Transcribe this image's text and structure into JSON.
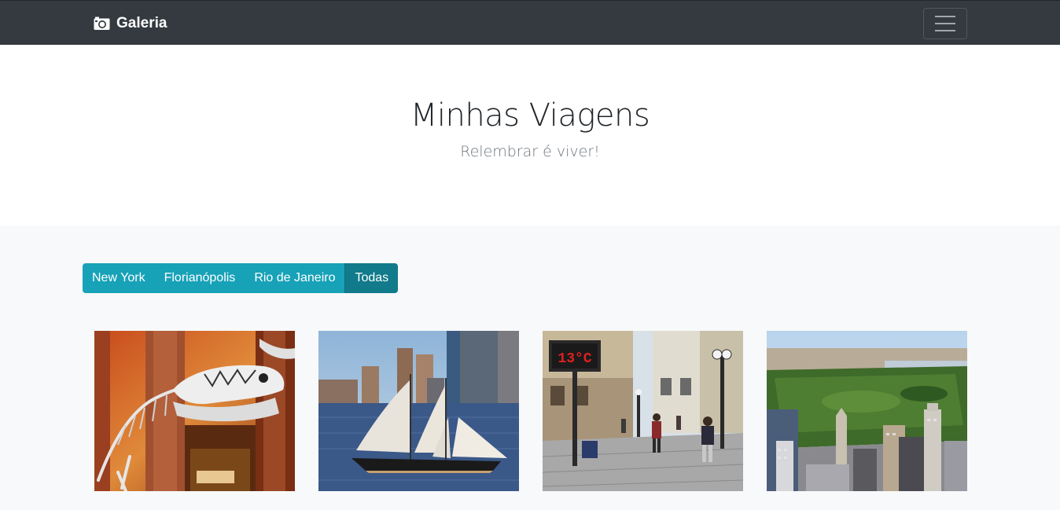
{
  "navbar": {
    "brand": "Galeria",
    "brand_icon": "camera-icon",
    "toggler_icon": "hamburger-menu-icon"
  },
  "hero": {
    "title": "Minhas Viagens",
    "subtitle": "Relembrar é viver!"
  },
  "filters": [
    {
      "label": "New York",
      "active": false
    },
    {
      "label": "Florianópolis",
      "active": false
    },
    {
      "label": "Rio de Janeiro",
      "active": false
    },
    {
      "label": "Todas",
      "active": true
    }
  ],
  "colors": {
    "navbar": "#343a40",
    "filter_button": "#17a2b8",
    "filter_button_active": "#117a8b",
    "page_background": "#f8f9fa"
  },
  "gallery": {
    "photos": [
      {
        "subject": "dinosaur-skeleton-museum"
      },
      {
        "subject": "sailboat-harbor-skyline"
      },
      {
        "subject": "pedestrian-street-thermometer",
        "sign_text": "13°C"
      },
      {
        "subject": "aerial-city-park"
      }
    ]
  }
}
